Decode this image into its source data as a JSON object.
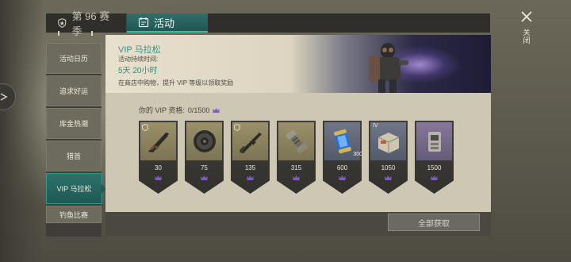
{
  "tabs": {
    "season_label": "第 96 赛季",
    "activity_label": "活动"
  },
  "menu": {
    "items": [
      {
        "label": "活动日历"
      },
      {
        "label": "追求好运"
      },
      {
        "label": "库金热潮"
      },
      {
        "label": "猎首"
      },
      {
        "label": "VIP 马拉松"
      },
      {
        "label": "钓鱼比赛"
      }
    ],
    "selected_index": 4
  },
  "banner": {
    "title": "VIP 马拉松",
    "duration_label": "活动持续时间:",
    "duration_value": "5天 20小时",
    "description": "在商店中购物，提升 VIP 等级以领取奖励"
  },
  "qualification": {
    "label": "你的 VIP 资格:",
    "value": "0/1500"
  },
  "rewards": [
    {
      "amount": "30",
      "icon": "shotgun-icon",
      "rarity": "tan"
    },
    {
      "amount": "75",
      "icon": "landmine-icon",
      "rarity": "tan"
    },
    {
      "amount": "135",
      "icon": "rifle-icon",
      "rarity": "tan"
    },
    {
      "amount": "315",
      "icon": "tool-part-icon",
      "rarity": "tan"
    },
    {
      "amount": "600",
      "icon": "energy-can-icon",
      "rarity": "blue",
      "quantity": "300"
    },
    {
      "amount": "1050",
      "icon": "supply-crate-icon",
      "rarity": "blue",
      "tier": "IV"
    },
    {
      "amount": "1500",
      "icon": "machine-icon",
      "rarity": "purple"
    }
  ],
  "claim_button_label": "全部获取",
  "close_label": "关闭",
  "colors": {
    "accent_teal": "#2d716b",
    "crown_purple": "#7f5bc9",
    "content_bg": "#cdc7b3"
  }
}
